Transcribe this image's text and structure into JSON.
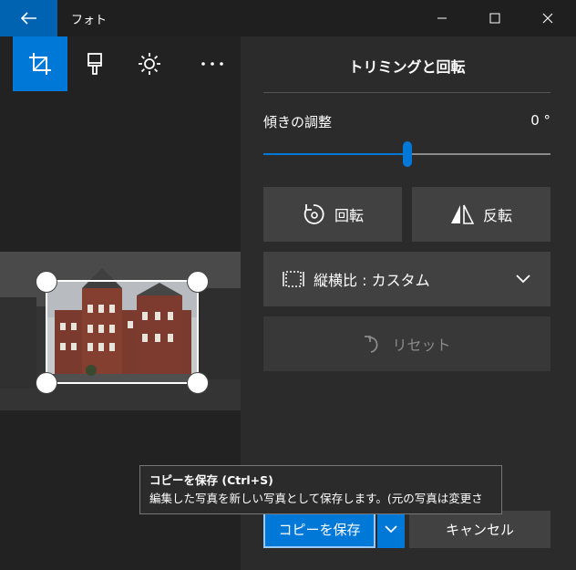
{
  "window": {
    "app_title": "フォト"
  },
  "toolbar": {
    "tools": [
      {
        "name": "crop",
        "icon": "crop-icon"
      },
      {
        "name": "filters",
        "icon": "brush-icon"
      },
      {
        "name": "adjust",
        "icon": "brightness-icon"
      },
      {
        "name": "more",
        "icon": "more-icon"
      }
    ]
  },
  "panel": {
    "title": "トリミングと回転",
    "straighten_label": "傾きの調整",
    "straighten_value": "0 °",
    "straighten_fraction": 0.5,
    "rotate_label": "回転",
    "flip_label": "反転",
    "aspect_label": "縦横比 : カスタム",
    "reset_label": "リセット"
  },
  "tooltip": {
    "title": "コピーを保存 (Ctrl+S)",
    "description": "編集した写真を新しい写真として保存します。(元の写真は変更さ"
  },
  "footer": {
    "save_copy_label": "コピーを保存",
    "cancel_label": "キャンセル"
  },
  "colors": {
    "accent": "#0078d7",
    "background": "#2b2b2b",
    "button": "#414141"
  }
}
